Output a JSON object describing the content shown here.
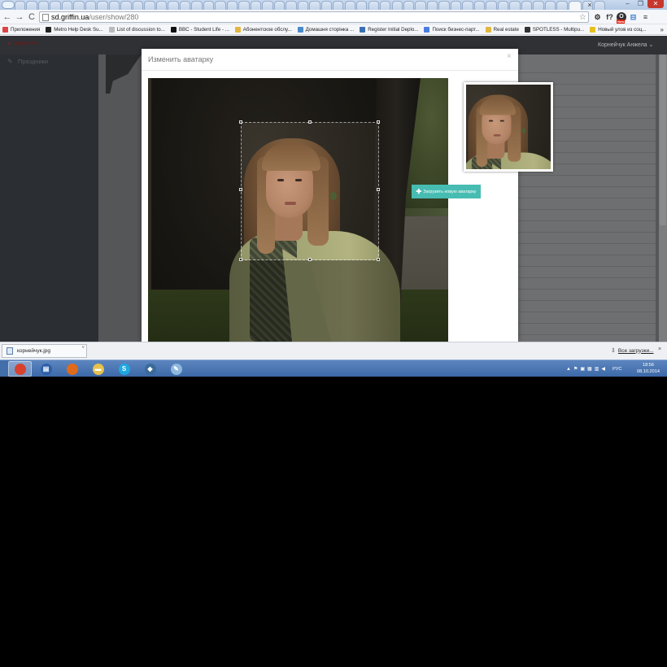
{
  "browser": {
    "tab_close": "×",
    "window_controls": [
      "–",
      "❐",
      "✕"
    ],
    "back_icon": "←",
    "forward_icon": "→",
    "reload_icon": "C",
    "url_host": "sd.griffin.ua",
    "url_path": "/user/show/280",
    "bookmark_star_icon": "☆",
    "extension_icons": [
      "⚙",
      "f?",
      "O",
      "⊟",
      "≡"
    ],
    "extension_badge": "New",
    "bookmarks_more": "»",
    "bookmarks": [
      {
        "label": "Приложения",
        "icon": "apps-grid-icon",
        "color": "#d44"
      },
      {
        "label": "Metro Help Desk Su...",
        "icon": "metro-icon",
        "color": "#222"
      },
      {
        "label": "List of discussion to...",
        "icon": "page-icon",
        "color": "#bbb"
      },
      {
        "label": "BBC - Student Life - ...",
        "icon": "bbc-icon",
        "color": "#111"
      },
      {
        "label": "Абонентское обслу...",
        "icon": "folder-icon",
        "color": "#e2b740"
      },
      {
        "label": "Домашня сторінка ...",
        "icon": "people-icon",
        "color": "#4a8ac8"
      },
      {
        "label": "Register Initial Deplo...",
        "icon": "form-icon",
        "color": "#3b6fb4"
      },
      {
        "label": "Поиск бизнес-парт...",
        "icon": "google-icon",
        "color": "#4a7de0"
      },
      {
        "label": "Real estate",
        "icon": "folder-icon",
        "color": "#e2b740"
      },
      {
        "label": "SPOTLESS - Multipu...",
        "icon": "spotless-icon",
        "color": "#333"
      },
      {
        "label": "Новый улов из соц...",
        "icon": "fish-icon",
        "color": "#e5c020"
      }
    ]
  },
  "site": {
    "logo": "GRIFFIN",
    "logo_mark": "≡",
    "user_menu": "Корнейчук Анжела ⌄",
    "sidebar_item": "Праздники",
    "sidebar_item_icon": "✎"
  },
  "modal": {
    "title": "Изменить аватарку",
    "close": "×",
    "upload_button_icon": "✚",
    "upload_button": "Загрузить новую аватарку"
  },
  "downloads": {
    "file_name": "корнейчук.jpg",
    "arrow": "˅",
    "all_downloads_icon": "⇩",
    "all_downloads": "Все загрузки...",
    "close": "×"
  },
  "taskbar": {
    "apps": [
      {
        "name": "chrome",
        "glyph": "",
        "color": "#d9412f",
        "active": true
      },
      {
        "name": "save",
        "glyph": "▤",
        "color": "#2b5fa8",
        "active": false
      },
      {
        "name": "firefox",
        "glyph": "",
        "color": "#e06a1c",
        "active": false
      },
      {
        "name": "explorer",
        "glyph": "▬",
        "color": "#e7c24c",
        "active": false
      },
      {
        "name": "skype",
        "glyph": "S",
        "color": "#1ea8e0",
        "active": false
      },
      {
        "name": "postgres",
        "glyph": "◆",
        "color": "#3a6a99",
        "active": false
      },
      {
        "name": "notepad",
        "glyph": "✎",
        "color": "#8fb8e0",
        "active": false
      }
    ],
    "language": "РУС",
    "time": "18:56",
    "date": "08.10.2014"
  }
}
